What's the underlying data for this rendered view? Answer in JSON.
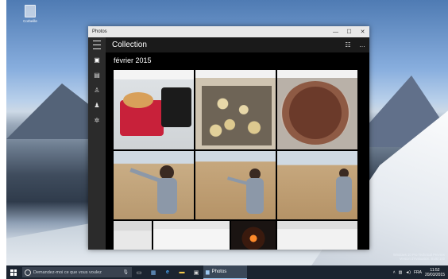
{
  "desktop": {
    "recycle_bin_label": "Corbeille",
    "watermark_line1": "Windows 10 Pro Technical Preview",
    "watermark_line2": "Version d'évaluation. Build 100",
    "watermark_line3": "Windows 10 Pro Technical Preview"
  },
  "window": {
    "title": "Photos",
    "minimize": "—",
    "maximize": "☐",
    "close": "✕"
  },
  "sidebar": {
    "items": [
      {
        "name": "menu",
        "icon": "hamburger-icon"
      },
      {
        "name": "collection",
        "icon": "collection-icon",
        "glyph": "▣"
      },
      {
        "name": "albums",
        "icon": "albums-icon",
        "glyph": "▤"
      },
      {
        "name": "folders",
        "icon": "people-icon",
        "glyph": "♙"
      },
      {
        "name": "people",
        "icon": "people-group-icon",
        "glyph": "♟"
      },
      {
        "name": "settings",
        "icon": "gear-icon",
        "glyph": "✲"
      }
    ]
  },
  "header": {
    "title": "Collection",
    "select_icon": "select-icon",
    "select_glyph": "☷",
    "more_glyph": "…"
  },
  "main": {
    "date_heading": "février 2015"
  },
  "taskbar": {
    "search_placeholder": "Demandez-moi ce que vous voulez",
    "mic_glyph": "🎙",
    "active_app": "Photos",
    "language": "FRA",
    "time": "11:52",
    "date": "20/03/2015"
  }
}
